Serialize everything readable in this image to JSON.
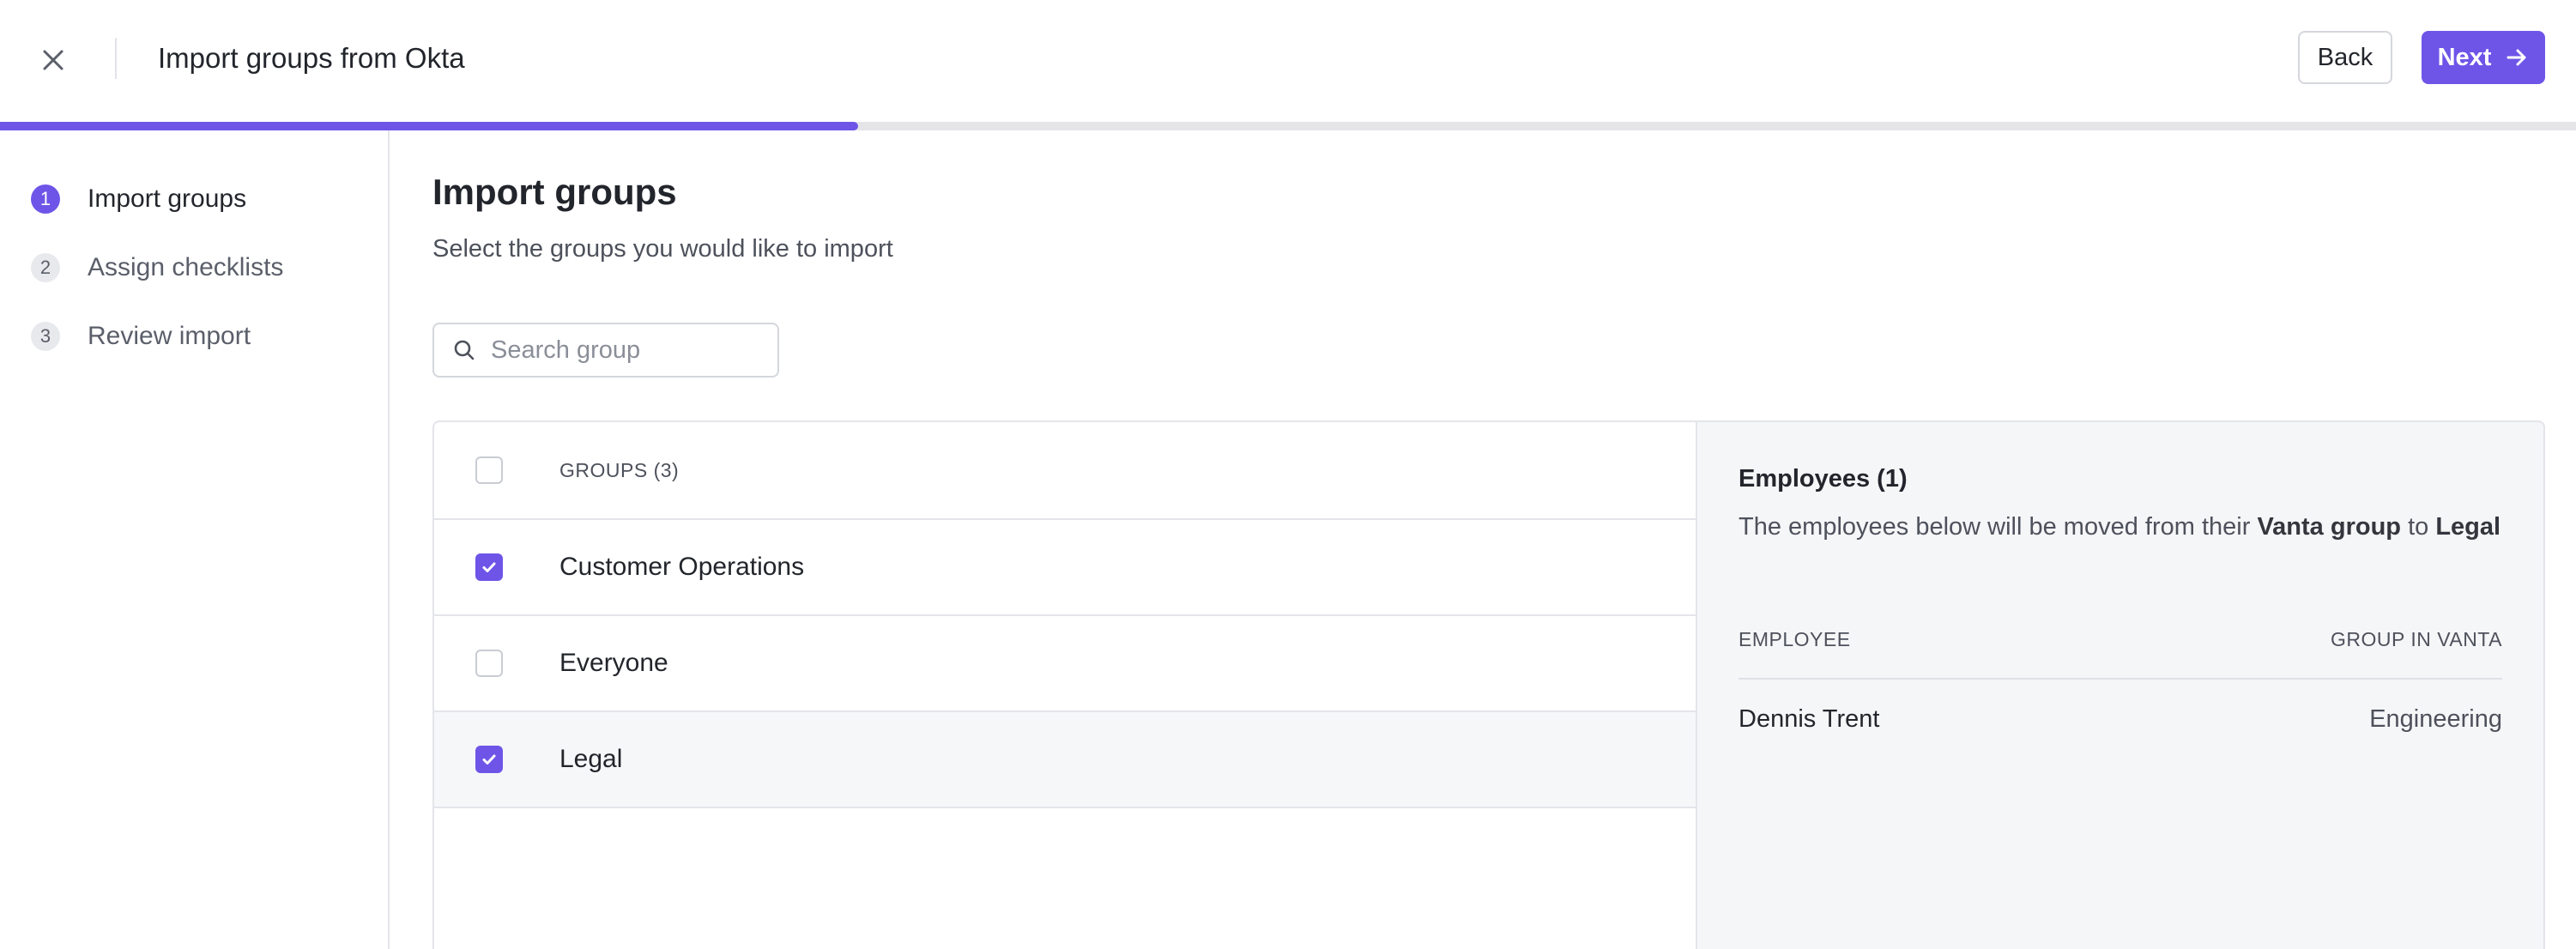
{
  "header": {
    "title": "Import groups from Okta",
    "back_label": "Back",
    "next_label": "Next",
    "close_icon": "close-icon",
    "next_icon": "arrow-right-icon"
  },
  "progress": {
    "fraction": 0.333,
    "color": "#6e55e8"
  },
  "steps": [
    {
      "number": "1",
      "label": "Import groups",
      "active": true
    },
    {
      "number": "2",
      "label": "Assign checklists",
      "active": false
    },
    {
      "number": "3",
      "label": "Review import",
      "active": false
    }
  ],
  "main": {
    "title": "Import groups",
    "subtitle": "Select the groups you would like to import",
    "search": {
      "placeholder": "Search group",
      "value": "",
      "icon": "search-icon"
    }
  },
  "groups": {
    "header_label": "GROUPS (3)",
    "items": [
      {
        "label": "Customer Operations",
        "checked": true
      },
      {
        "label": "Everyone",
        "checked": false
      },
      {
        "label": "Legal",
        "checked": true
      }
    ]
  },
  "employees": {
    "title": "Employees (1)",
    "desc_prefix": "The employees below will be moved from their ",
    "desc_bold1": "Vanta group",
    "desc_mid": " to ",
    "desc_bold2": "Legal",
    "col_employee": "EMPLOYEE",
    "col_group": "GROUP IN VANTA",
    "rows": [
      {
        "name": "Dennis Trent",
        "group": "Engineering"
      }
    ]
  },
  "colors": {
    "accent": "#6e55e8",
    "border": "#e4e5ea",
    "panel_bg": "#f5f6f8"
  }
}
